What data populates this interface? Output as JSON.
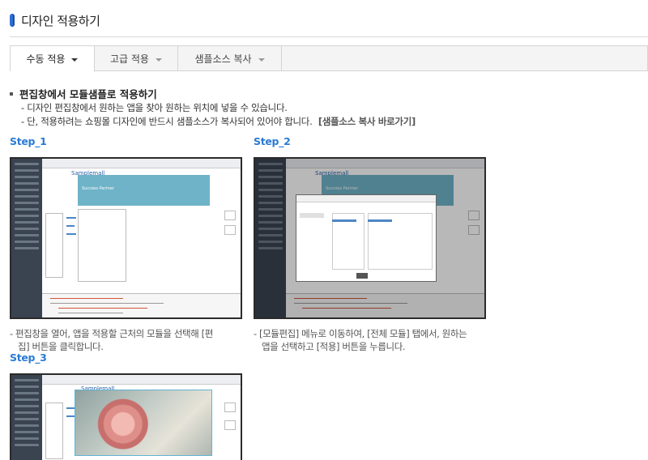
{
  "page": {
    "title": "디자인 적용하기",
    "accent_color": "#2f6fd3",
    "step_color": "#2a7bd3"
  },
  "tabs": [
    {
      "label": "수동 적용",
      "active": true
    },
    {
      "label": "고급 적용",
      "active": false
    },
    {
      "label": "샘플소스 복사",
      "active": false
    }
  ],
  "section": {
    "heading": "편집창에서 모듈샘플로 적용하기",
    "desc1": "- 디자인 편집창에서 원하는 앱을 찾아 원하는 위치에 넣을 수 있습니다.",
    "desc2": "- 단, 적용하려는 쇼핑몰 디자인에 반드시 샘플소스가 복사되어 있어야 합니다.",
    "link": "[샘플소스 복사 바로가기]"
  },
  "steps": [
    {
      "label": "Step_1",
      "caption_line1": "- 편집창을 열어, 앱을 적용할 근처의 모듈을 선택해 [편",
      "caption_line2": "집] 버튼을 클릭합니다.",
      "shot": {
        "logo": "Samplemall",
        "banner": "Success Partner"
      }
    },
    {
      "label": "Step_2",
      "caption_line1": "- [모듈편집] 메뉴로 이동하여, [전체 모듈] 탭에서, 원하는",
      "caption_line2": "앱을 선택하고 [적용] 버튼을 누릅니다.",
      "shot": {
        "logo": "Samplemall",
        "banner": "Success Partner"
      }
    },
    {
      "label": "Step_3",
      "shot": {
        "logo": "Samplemall"
      }
    }
  ]
}
